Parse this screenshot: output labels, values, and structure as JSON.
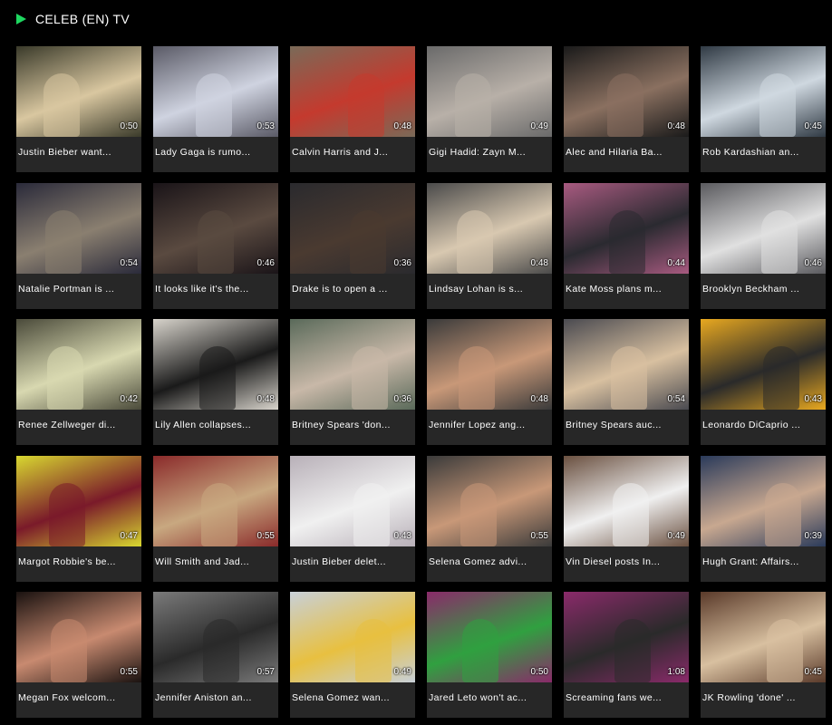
{
  "header": {
    "title": "CELEB (EN) TV",
    "accent": "#1ed760"
  },
  "videos": [
    {
      "title": "Justin Bieber want...",
      "duration": "0:50",
      "tone": "#3a3a2a",
      "tone2": "#d9c7a0"
    },
    {
      "title": "Lady Gaga is rumo...",
      "duration": "0:53",
      "tone": "#5a5a66",
      "tone2": "#cfd3e0"
    },
    {
      "title": "Calvin Harris and J...",
      "duration": "0:48",
      "tone": "#7a6a58",
      "tone2": "#c43a2e"
    },
    {
      "title": "Gigi Hadid: Zayn M...",
      "duration": "0:49",
      "tone": "#6a6a6a",
      "tone2": "#b8b0a8"
    },
    {
      "title": "Alec and Hilaria Ba...",
      "duration": "0:48",
      "tone": "#1a1a1a",
      "tone2": "#8a7060"
    },
    {
      "title": "Rob Kardashian an...",
      "duration": "0:45",
      "tone": "#303a44",
      "tone2": "#cfd8e0"
    },
    {
      "title": "Natalie Portman is ...",
      "duration": "0:54",
      "tone": "#2a2a3a",
      "tone2": "#8a7f70"
    },
    {
      "title": "It looks like it's the...",
      "duration": "0:46",
      "tone": "#1a1418",
      "tone2": "#5a4a40"
    },
    {
      "title": "Drake is to open a ...",
      "duration": "0:36",
      "tone": "#2a2a2e",
      "tone2": "#4a3a30"
    },
    {
      "title": "Lindsay Lohan is s...",
      "duration": "0:48",
      "tone": "#4a4a4a",
      "tone2": "#d8c8b0"
    },
    {
      "title": "Kate Moss plans m...",
      "duration": "0:44",
      "tone": "#a85a80",
      "tone2": "#2a2a30"
    },
    {
      "title": "Brooklyn Beckham ...",
      "duration": "0:46",
      "tone": "#5a5a5e",
      "tone2": "#e0e0e0"
    },
    {
      "title": "Renee Zellweger di...",
      "duration": "0:42",
      "tone": "#4a4a3a",
      "tone2": "#d8d8b0"
    },
    {
      "title": "Lily Allen collapses...",
      "duration": "0:48",
      "tone": "#d8d4cc",
      "tone2": "#1a1a1a"
    },
    {
      "title": "Britney Spears 'don...",
      "duration": "0:36",
      "tone": "#5a6a5a",
      "tone2": "#c8b8a8"
    },
    {
      "title": "Jennifer Lopez ang...",
      "duration": "0:48",
      "tone": "#3a3a3a",
      "tone2": "#c89878"
    },
    {
      "title": "Britney Spears auc...",
      "duration": "0:54",
      "tone": "#4a4a50",
      "tone2": "#d8c0a0"
    },
    {
      "title": "Leonardo DiCaprio ...",
      "duration": "0:43",
      "tone": "#e8a820",
      "tone2": "#2a2a2a"
    },
    {
      "title": "Margot Robbie's be...",
      "duration": "0:47",
      "tone": "#d8d830",
      "tone2": "#7a1a2a"
    },
    {
      "title": "Will Smith and Jad...",
      "duration": "0:55",
      "tone": "#8a2a2a",
      "tone2": "#c8a880"
    },
    {
      "title": "Justin Bieber delet...",
      "duration": "0:43",
      "tone": "#b8b0b8",
      "tone2": "#f0f0f0"
    },
    {
      "title": "Selena Gomez advi...",
      "duration": "0:55",
      "tone": "#3a3a3a",
      "tone2": "#c89878"
    },
    {
      "title": "Vin Diesel posts In...",
      "duration": "0:49",
      "tone": "#6a5040",
      "tone2": "#f0f0f0"
    },
    {
      "title": "Hugh Grant: Affairs...",
      "duration": "0:39",
      "tone": "#2a3a5a",
      "tone2": "#c8a890"
    },
    {
      "title": "Megan Fox welcom...",
      "duration": "0:55",
      "tone": "#1a1210",
      "tone2": "#c88a70"
    },
    {
      "title": "Jennifer Aniston an...",
      "duration": "0:57",
      "tone": "#7a7a7a",
      "tone2": "#2a2a2a"
    },
    {
      "title": "Selena Gomez wan...",
      "duration": "0:49",
      "tone": "#c8d0d8",
      "tone2": "#e8c040"
    },
    {
      "title": "Jared Leto won't ac...",
      "duration": "0:50",
      "tone": "#8a2a6a",
      "tone2": "#30a040"
    },
    {
      "title": "Screaming fans we...",
      "duration": "1:08",
      "tone": "#8a2a6a",
      "tone2": "#2a2a2a"
    },
    {
      "title": "JK Rowling 'done' ...",
      "duration": "0:45",
      "tone": "#5a3a2a",
      "tone2": "#d8c0a0"
    }
  ]
}
